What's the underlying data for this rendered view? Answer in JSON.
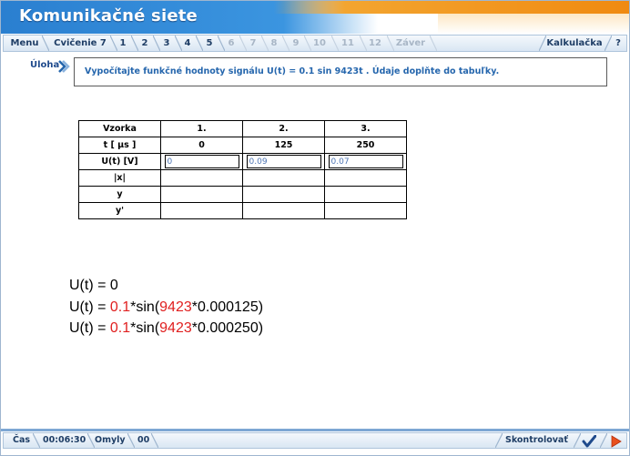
{
  "window": {
    "title": "Komunikačné siete"
  },
  "nav": {
    "menu": "Menu",
    "exercise": "Cvičenie 7",
    "steps": [
      "1",
      "2",
      "3",
      "4",
      "5",
      "6",
      "7",
      "8",
      "9",
      "10",
      "11",
      "12"
    ],
    "active_steps": [
      "1",
      "2",
      "3",
      "4",
      "5"
    ],
    "end": "Záver",
    "calculator": "Kalkulačka",
    "help": "?"
  },
  "task": {
    "label": "Úloha",
    "text": "Vypočítajte funkčné hodnoty signálu U(t) = 0.1 sin 9423t . Údaje doplňte do tabuľky."
  },
  "table": {
    "header": [
      "Vzorka",
      "1.",
      "2.",
      "3."
    ],
    "time_row": {
      "label": "t [ µs ]",
      "values": [
        "0",
        "125",
        "250"
      ]
    },
    "u_row": {
      "label": "U(t) [V]",
      "inputs": [
        "0",
        "0.09",
        "0.07"
      ]
    },
    "x_row": {
      "label": "|x|"
    },
    "y_row": {
      "label": "y"
    },
    "y2_row": {
      "label": "y'"
    }
  },
  "formulas": {
    "line1": "U(t) = 0",
    "line2": {
      "prefix": "U(t) = ",
      "amp": "0.1",
      "mid": "*sin(",
      "omega": "9423",
      "suffix": "*0.000125)"
    },
    "line3": {
      "prefix": "U(t) = ",
      "amp": "0.1",
      "mid": "*sin(",
      "omega": "9423",
      "suffix": "*0.000250)"
    }
  },
  "bottom": {
    "time_label": "Čas",
    "time_value": "00:06:30",
    "errors_label": "Omyly",
    "errors_value": "00",
    "check": "Skontrolovať"
  },
  "colors": {
    "accent": "#2566ad",
    "title_blue": "#2a7fd0",
    "title_orange": "#f08a10",
    "formula_red": "#e02020"
  }
}
